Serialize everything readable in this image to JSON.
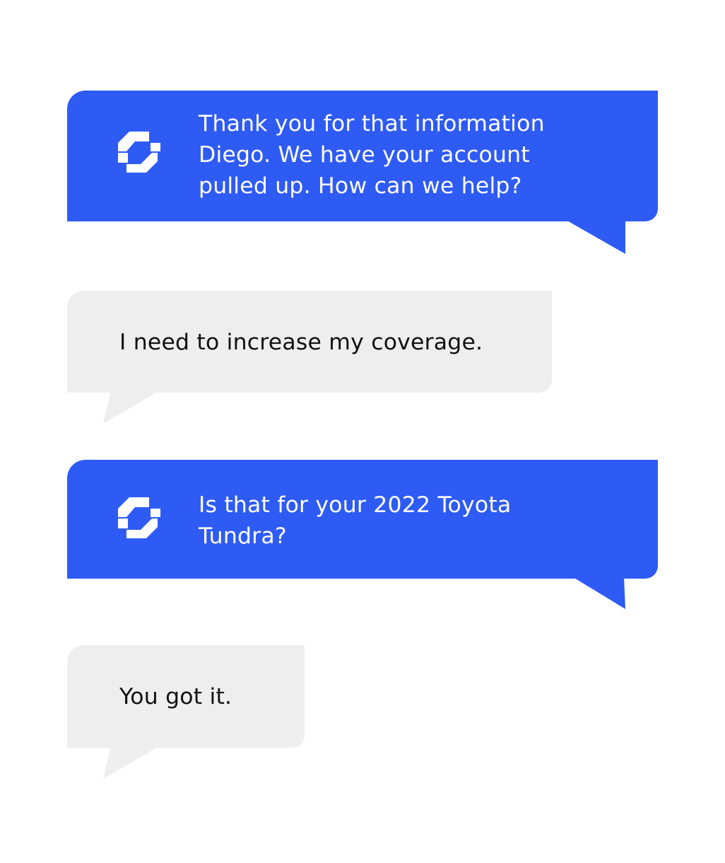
{
  "colors": {
    "bot_bubble": "#2f5bf5",
    "user_bubble": "#eeeeee",
    "bot_text": "#ffffff",
    "user_text": "#111111"
  },
  "messages": [
    {
      "sender": "agent",
      "avatar_icon": "brand-logo-icon",
      "lines": [
        "Thank you for that information",
        "Diego. We have your account",
        "pulled up. How can we help?"
      ]
    },
    {
      "sender": "user",
      "lines": [
        "I need to increase my coverage."
      ]
    },
    {
      "sender": "agent",
      "avatar_icon": "brand-logo-icon",
      "lines": [
        "Is that for your 2022 Toyota",
        "Tundra?"
      ]
    },
    {
      "sender": "user",
      "lines": [
        "You got it."
      ]
    }
  ]
}
